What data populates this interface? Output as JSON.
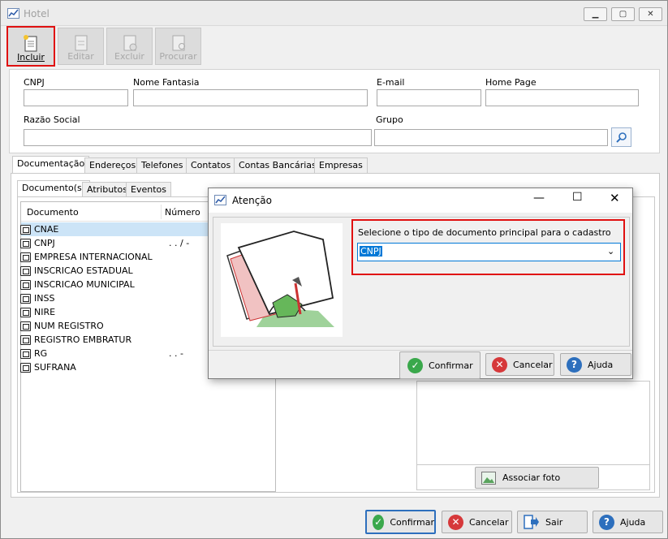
{
  "window": {
    "title": "Hotel",
    "min_icon": "minimize-icon",
    "max_icon": "maximize-icon",
    "close_icon": "close-icon"
  },
  "toolbar": {
    "incluir": "Incluir",
    "editar": "Editar",
    "excluir": "Excluir",
    "procurar": "Procurar"
  },
  "form": {
    "cnpj": "CNPJ",
    "nome_fantasia": "Nome Fantasia",
    "email": "E-mail",
    "home_page": "Home Page",
    "razao_social": "Razão Social",
    "grupo": "Grupo"
  },
  "tabs": [
    "Documentação",
    "Endereços",
    "Telefones",
    "Contatos",
    "Contas Bancárias",
    "Empresas"
  ],
  "subtabs": [
    "Documento(s)",
    "Atributos",
    "Eventos"
  ],
  "table": {
    "col_documento": "Documento",
    "col_numero": "Número",
    "rows": [
      {
        "name": "CNAE",
        "num": ""
      },
      {
        "name": "CNPJ",
        "num": ". . / -"
      },
      {
        "name": "EMPRESA INTERNACIONAL",
        "num": ""
      },
      {
        "name": "INSCRICAO ESTADUAL",
        "num": ""
      },
      {
        "name": "INSCRICAO MUNICIPAL",
        "num": ""
      },
      {
        "name": "INSS",
        "num": ""
      },
      {
        "name": "NIRE",
        "num": ""
      },
      {
        "name": "NUM REGISTRO",
        "num": ""
      },
      {
        "name": "REGISTRO EMBRATUR",
        "num": ""
      },
      {
        "name": "RG",
        "num": ". . -"
      },
      {
        "name": "SUFRANA",
        "num": ""
      }
    ]
  },
  "photo_button": "Associar foto",
  "footer": {
    "confirmar": "Confirmar",
    "cancelar": "Cancelar",
    "sair": "Sair",
    "ajuda": "Ajuda"
  },
  "dialog": {
    "title": "Atenção",
    "prompt": "Selecione o tipo de documento principal para o cadastro",
    "select_value": "CNPJ",
    "confirmar": "Confirmar",
    "cancelar": "Cancelar",
    "ajuda": "Ajuda"
  },
  "colors": {
    "highlight_red": "#e01010",
    "selection_blue": "#0078d7",
    "row_selected": "#cce4f7"
  }
}
